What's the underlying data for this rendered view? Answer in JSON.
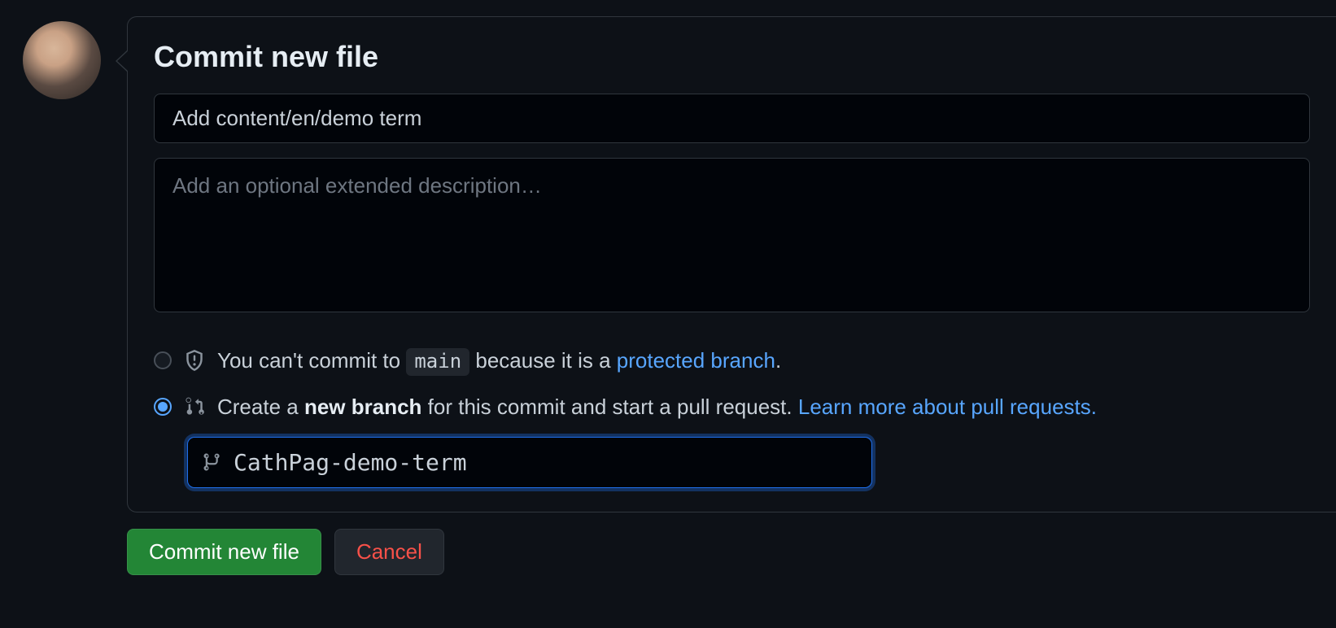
{
  "title": "Commit new file",
  "summary": {
    "value": "Add content/en/demo term"
  },
  "description": {
    "placeholder": "Add an optional extended description…"
  },
  "options": {
    "protected": {
      "pre": "You can't commit to ",
      "branch": "main",
      "post": " because it is a ",
      "link": "protected branch",
      "tail": "."
    },
    "newbranch": {
      "pre": "Create a ",
      "bold": "new branch",
      "post": " for this commit and start a pull request. ",
      "link": "Learn more about pull requests."
    }
  },
  "branch_input": {
    "value": "CathPag-demo-term"
  },
  "actions": {
    "commit": "Commit new file",
    "cancel": "Cancel"
  }
}
